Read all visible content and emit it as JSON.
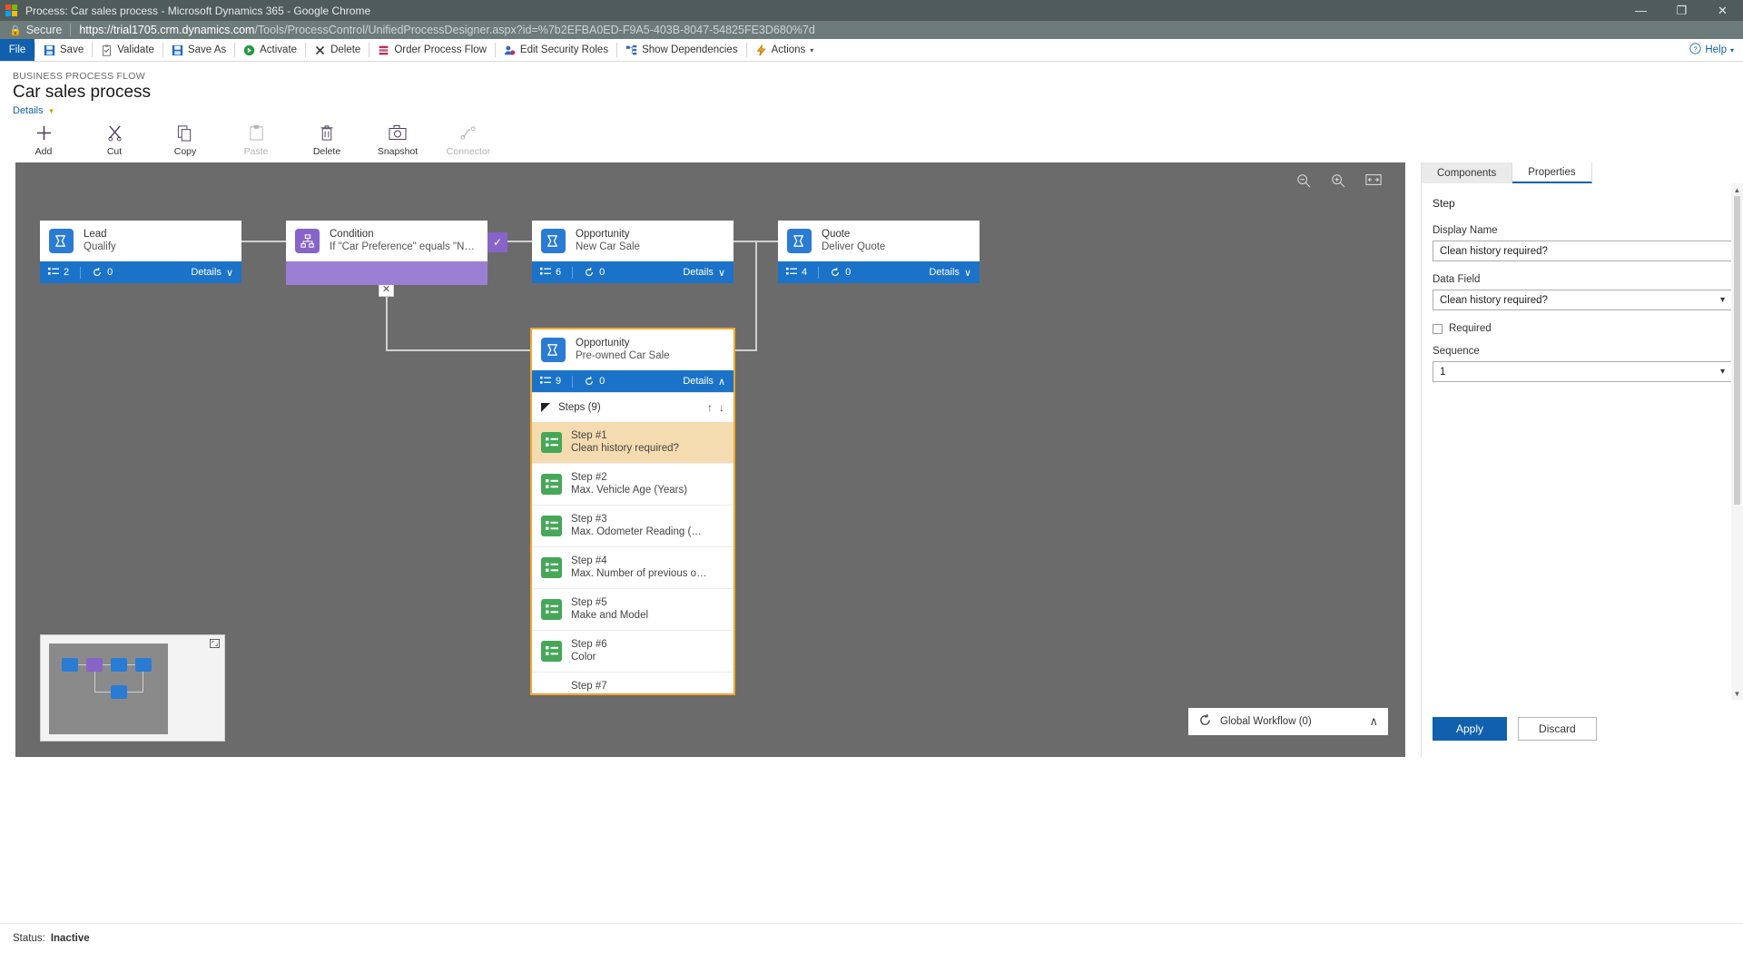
{
  "browser": {
    "title": "Process: Car sales process - Microsoft Dynamics 365 - Google Chrome",
    "secure_label": "Secure",
    "url_domain": "https://trial1705.crm.dynamics.com",
    "url_path": "/Tools/ProcessControl/UnifiedProcessDesigner.aspx?id=%7b2EFBA0ED-F9A5-403B-8047-54825FE3D680%7d",
    "minimize": "—",
    "maximize": "❐",
    "close": "✕"
  },
  "ribbon": {
    "file": "File",
    "items": [
      {
        "label": "Save",
        "icon": "save-icon"
      },
      {
        "label": "Validate",
        "icon": "validate-icon"
      },
      {
        "label": "Save As",
        "icon": "save-as-icon"
      },
      {
        "label": "Activate",
        "icon": "activate-icon"
      },
      {
        "label": "Delete",
        "icon": "delete-icon"
      },
      {
        "label": "Order Process Flow",
        "icon": "order-process-flow-icon"
      },
      {
        "label": "Edit Security Roles",
        "icon": "edit-security-roles-icon"
      },
      {
        "label": "Show Dependencies",
        "icon": "show-dependencies-icon"
      },
      {
        "label": "Actions",
        "icon": "actions-icon"
      }
    ],
    "help": "Help"
  },
  "header": {
    "kicker": "BUSINESS PROCESS FLOW",
    "title": "Car sales process",
    "details_link": "Details"
  },
  "toolbar": [
    {
      "label": "Add",
      "icon": "plus-icon",
      "disabled": false
    },
    {
      "label": "Cut",
      "icon": "scissors-icon",
      "disabled": false
    },
    {
      "label": "Copy",
      "icon": "copy-icon",
      "disabled": false
    },
    {
      "label": "Paste",
      "icon": "paste-icon",
      "disabled": true
    },
    {
      "label": "Delete",
      "icon": "trash-icon",
      "disabled": false
    },
    {
      "label": "Snapshot",
      "icon": "camera-icon",
      "disabled": false
    },
    {
      "label": "Connector",
      "icon": "connector-icon",
      "disabled": true
    }
  ],
  "canvas": {
    "zoom_out_icon": "zoom-out-icon",
    "zoom_in_icon": "zoom-in-icon",
    "fit_icon": "fit-to-screen-icon",
    "nodes": [
      {
        "id": "lead",
        "entity": "Lead",
        "stage": "Qualify",
        "icon": "stage-flag-icon",
        "color": "#2a7bd4",
        "steps_count": "2",
        "workflow_count": "0",
        "details_label": "Details",
        "details_caret": "∨"
      },
      {
        "id": "condition",
        "entity": "Condition",
        "stage": "If \"Car Preference\" equals \"New ...",
        "icon": "condition-branch-icon",
        "color": "#8764c8",
        "check_icon": "check-icon"
      },
      {
        "id": "opportunity-new",
        "entity": "Opportunity",
        "stage": "New Car Sale",
        "icon": "stage-flag-icon",
        "color": "#2a7bd4",
        "steps_count": "6",
        "workflow_count": "0",
        "details_label": "Details",
        "details_caret": "∨"
      },
      {
        "id": "quote",
        "entity": "Quote",
        "stage": "Deliver Quote",
        "icon": "stage-flag-icon",
        "color": "#2a7bd4",
        "steps_count": "4",
        "workflow_count": "0",
        "details_label": "Details",
        "details_caret": "∨"
      },
      {
        "id": "opportunity-preowned",
        "entity": "Opportunity",
        "stage": "Pre-owned Car Sale",
        "icon": "stage-flag-icon",
        "color": "#2a7bd4",
        "steps_count": "9",
        "workflow_count": "0",
        "details_label": "Details",
        "details_caret": "∧"
      }
    ],
    "close_branch_icon": "✕",
    "steps_panel": {
      "header": "Steps (9)",
      "move_up_icon": "↑",
      "move_down_icon": "↓",
      "steps": [
        {
          "title": "Step #1",
          "field": "Clean history required?",
          "selected": true
        },
        {
          "title": "Step #2",
          "field": "Max. Vehicle Age (Years)",
          "selected": false
        },
        {
          "title": "Step #3",
          "field": "Max. Odometer Reading (Max)",
          "selected": false
        },
        {
          "title": "Step #4",
          "field": "Max. Number of previous ow...",
          "selected": false
        },
        {
          "title": "Step #5",
          "field": "Make and Model",
          "selected": false
        },
        {
          "title": "Step #6",
          "field": "Color",
          "selected": false
        },
        {
          "title": "Step #7",
          "field": "",
          "selected": false
        }
      ]
    },
    "global_workflow": {
      "label": "Global Workflow (0)",
      "icon": "workflow-icon",
      "collapse_caret": "∧"
    },
    "minimap": {
      "expand_icon": "minimap-expand-icon"
    }
  },
  "properties": {
    "tabs": [
      {
        "label": "Components",
        "active": false
      },
      {
        "label": "Properties",
        "active": true
      }
    ],
    "section_title": "Step",
    "display_name_label": "Display Name",
    "display_name_value": "Clean history required?",
    "data_field_label": "Data Field",
    "data_field_value": "Clean history required?",
    "required_label": "Required",
    "required_checked": false,
    "sequence_label": "Sequence",
    "sequence_value": "1",
    "apply_label": "Apply",
    "discard_label": "Discard"
  },
  "status": {
    "label": "Status:",
    "value": "Inactive"
  }
}
